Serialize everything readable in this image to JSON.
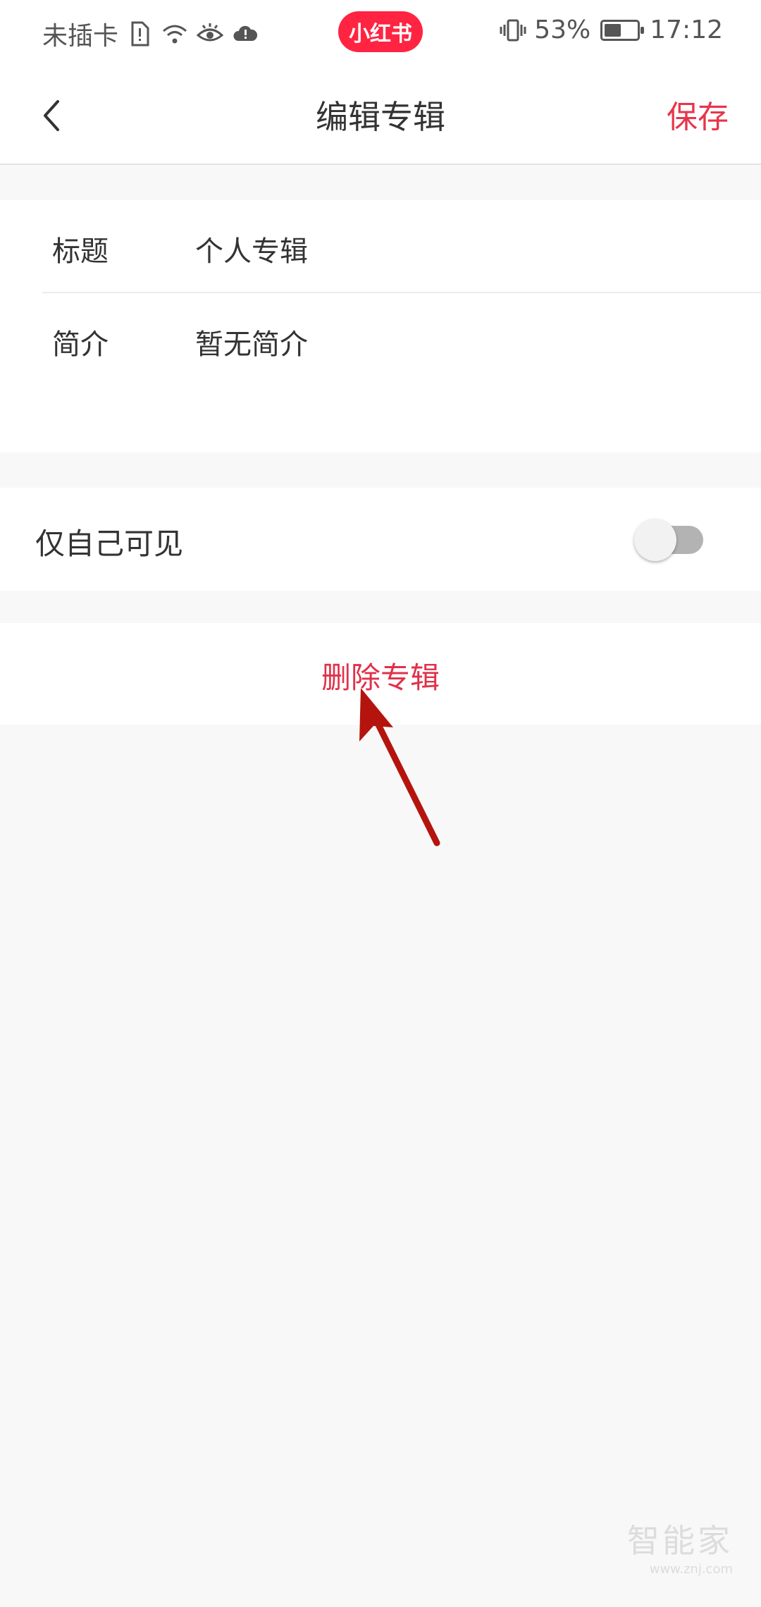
{
  "status_bar": {
    "carrier": "未插卡",
    "app_badge": "小红书",
    "battery": "53%",
    "battery_level": 0.53,
    "time": "17:12"
  },
  "nav": {
    "title": "编辑专辑",
    "save_label": "保存"
  },
  "form": {
    "title_label": "标题",
    "title_value": "个人专辑",
    "intro_label": "简介",
    "intro_value": "暂无简介"
  },
  "privacy": {
    "label": "仅自己可见",
    "enabled": false
  },
  "delete": {
    "label": "删除专辑"
  },
  "annotation": {
    "arrow_color": "#b5140e"
  },
  "watermark": {
    "main": "智能家",
    "sub": "www.znj.com"
  },
  "colors": {
    "accent": "#e8344a",
    "brand_badge": "#ff2442",
    "background": "#f8f8f8"
  }
}
